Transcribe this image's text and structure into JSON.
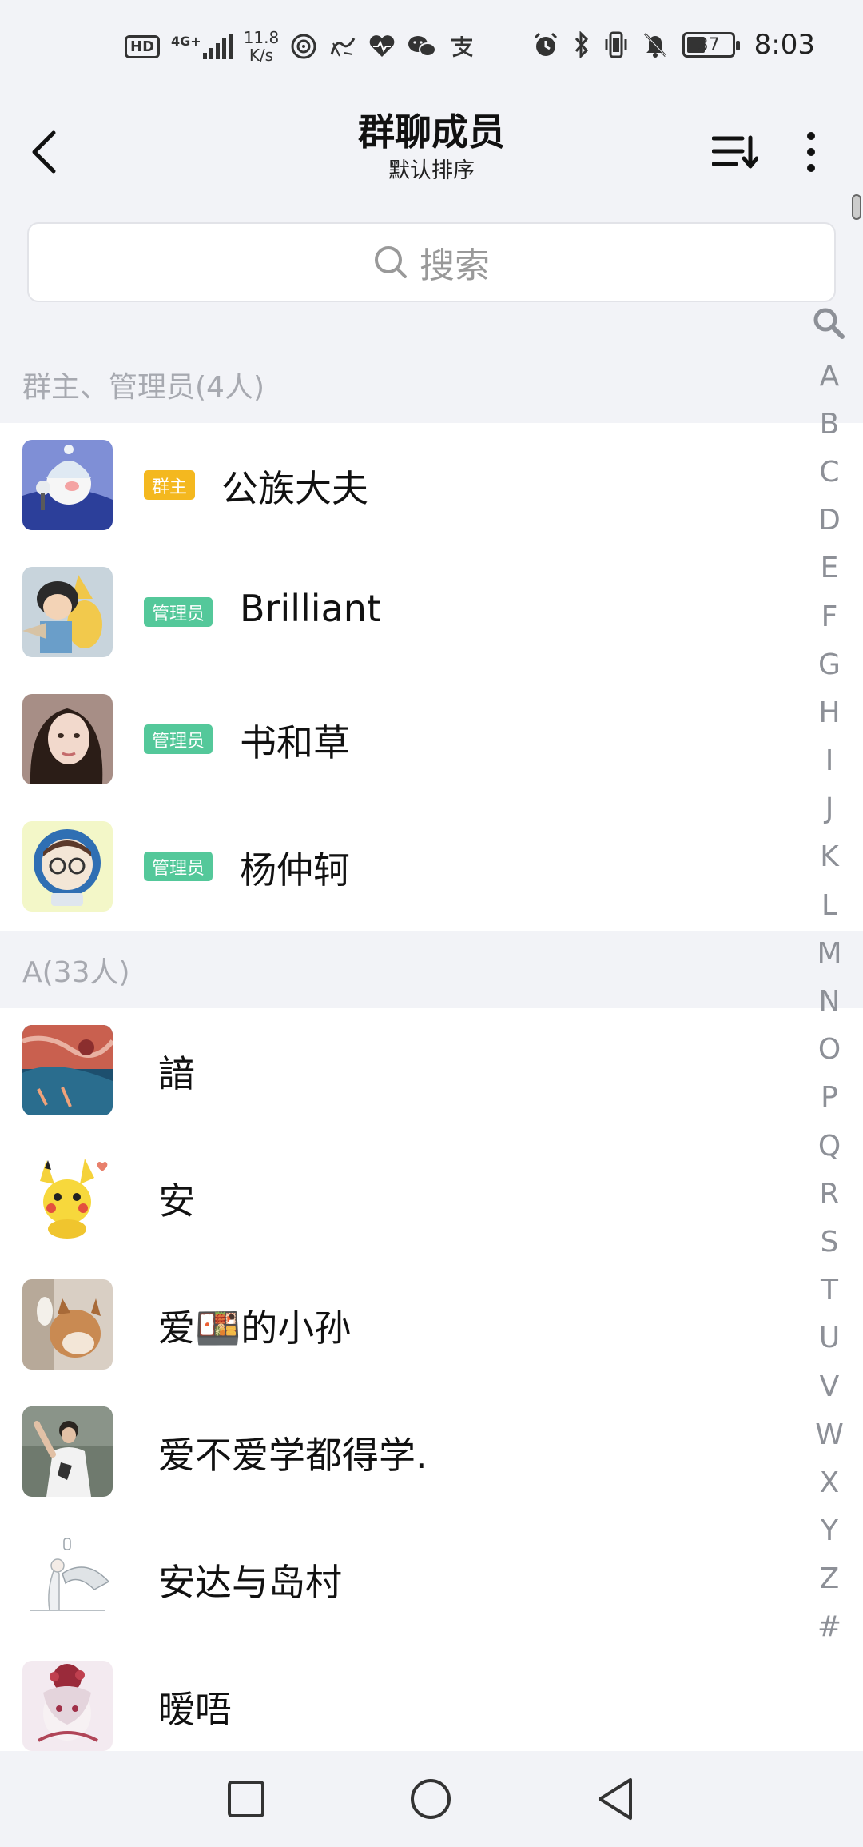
{
  "status_bar": {
    "hd": "HD",
    "network": "4G+",
    "speed_value": "11.8",
    "speed_unit": "K/s",
    "battery": "37",
    "time": "8:03",
    "left_icons": [
      "nfc-icon",
      "app-icon-1",
      "health-heart-icon",
      "wechat-icon",
      "alipay-icon"
    ],
    "right_icons": [
      "alarm-icon",
      "bluetooth-icon",
      "vibrate-icon",
      "mute-icon",
      "battery-icon"
    ]
  },
  "header": {
    "title": "群聊成员",
    "subtitle": "默认排序",
    "back_icon": "back-arrow-icon",
    "sort_icon": "sort-icon",
    "more_icon": "more-vertical-icon"
  },
  "search": {
    "placeholder": "搜索",
    "icon": "search-icon"
  },
  "sections": [
    {
      "header": "群主、管理员(4人)",
      "members": [
        {
          "name": "公族大夫",
          "badge": "群主",
          "badge_type": "owner"
        },
        {
          "name": "Brilliant",
          "badge": "管理员",
          "badge_type": "admin"
        },
        {
          "name": "书和草",
          "badge": "管理员",
          "badge_type": "admin"
        },
        {
          "name": "杨仲轲",
          "badge": "管理员",
          "badge_type": "admin"
        }
      ]
    },
    {
      "header": "A(33人)",
      "members": [
        {
          "name": "諳",
          "badge": ""
        },
        {
          "name": "安",
          "badge": ""
        },
        {
          "name": "爱🍱的小孙",
          "badge": ""
        },
        {
          "name": "爱不爱学都得学.",
          "badge": ""
        },
        {
          "name": "安达与岛村",
          "badge": ""
        },
        {
          "name": "暧唔",
          "badge": ""
        }
      ]
    }
  ],
  "alphabet_index": [
    "A",
    "B",
    "C",
    "D",
    "E",
    "F",
    "G",
    "H",
    "I",
    "J",
    "K",
    "L",
    "M",
    "N",
    "O",
    "P",
    "Q",
    "R",
    "S",
    "T",
    "U",
    "V",
    "W",
    "X",
    "Y",
    "Z",
    "#"
  ],
  "nav_bar": {
    "icons": [
      "recents-square-icon",
      "home-circle-icon",
      "back-triangle-icon"
    ]
  },
  "colors": {
    "owner_badge": "#f4b81f",
    "admin_badge": "#54c89a",
    "background": "#f2f3f7"
  }
}
